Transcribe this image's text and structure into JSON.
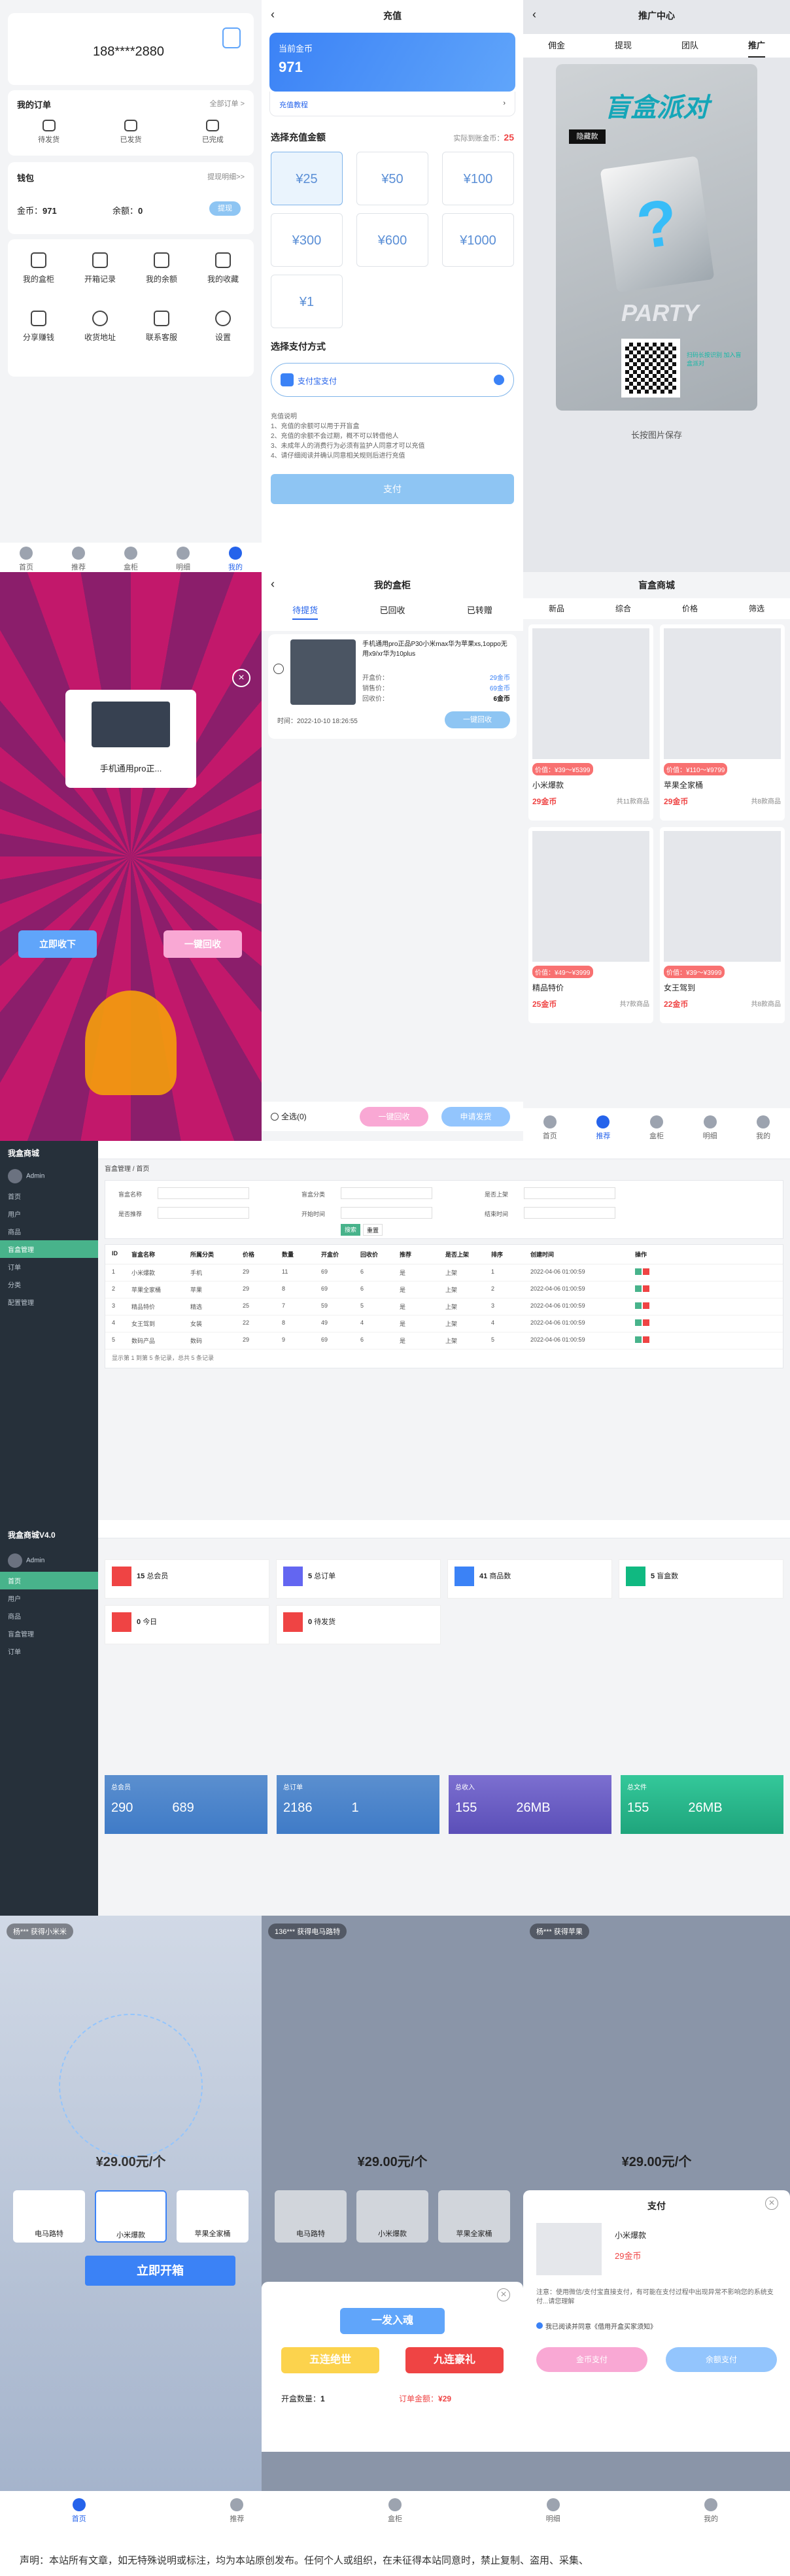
{
  "s1": {
    "phone": "188****2880",
    "orders_title": "我的订单",
    "orders_all": "全部订单 >",
    "order_tabs": [
      "待发货",
      "已发货",
      "已完成"
    ],
    "wallet_title": "钱包",
    "withdraw": "提现明细>>",
    "coin_label": "金币：",
    "coin_value": "971",
    "balance_label": "余额：",
    "balance_value": "0",
    "withdraw_btn": "提现",
    "grid": [
      "我的盒柜",
      "开箱记录",
      "我的余额",
      "我的收藏",
      "分享赚钱",
      "收货地址",
      "联系客服",
      "设置"
    ],
    "tabs": [
      "首页",
      "推荐",
      "盒柜",
      "明细",
      "我的"
    ]
  },
  "s2": {
    "title": "充值",
    "current_coin_label": "当前金币",
    "current_coin": "971",
    "tutorial": "充值教程",
    "select_label": "选择充值金额",
    "actual_label": "实际到账金币：",
    "actual_value": "25",
    "amounts": [
      "¥25",
      "¥50",
      "¥100",
      "¥300",
      "¥600",
      "¥1000",
      "¥1"
    ],
    "pay_method": "选择支付方式",
    "alipay": "支付宝支付",
    "notes": [
      "充值说明",
      "1、充值的余额可以用于开盲盒",
      "2、充值的余额不会过期，概不可以转借他人",
      "3、未成年人的消费行为必须有监护人同意才可以充值",
      "4、请仔细阅读并确认同意相关规则后进行充值"
    ],
    "pay_btn": "支付"
  },
  "s3": {
    "title": "推广中心",
    "tabs": [
      "佣金",
      "提现",
      "团队",
      "推广"
    ],
    "poster_title": "盲盒派对",
    "poster_tag": "隐藏款",
    "poster_sub": "PARTY",
    "qr_text": "扫码长按识别 加入盲盒派对",
    "save": "长按图片保存"
  },
  "s4": {
    "card_label": "手机通用pro正...",
    "btn_receive": "立即收下",
    "btn_recycle": "一键回收"
  },
  "s5": {
    "title": "我的盒柜",
    "tabs": [
      "待提货",
      "已回收",
      "已转赠"
    ],
    "product": "手机通用pro正品P30小米max华为苹果xs,1oppo无用x9/xr华为10plus",
    "open_price_label": "开盒价：",
    "open_price": "29金币",
    "sell_price_label": "销售价：",
    "sell_price": "69金币",
    "recycle_label": "回收价：",
    "recycle_price": "6金币",
    "time": "时间：2022-10-10 18:26:55",
    "one_recycle": "一键回收",
    "select_all": "全选(0)",
    "btn_recycle": "一键回收",
    "btn_ship": "申请发货"
  },
  "s6": {
    "title": "盲盒商城",
    "filters": [
      "新品",
      "综合",
      "价格",
      "筛选"
    ],
    "products": [
      {
        "name": "小米爆款",
        "range": "价值：¥39～¥5399",
        "price": "29金币",
        "count": "共11款商品"
      },
      {
        "name": "苹果全家桶",
        "range": "价值：¥110～¥9799",
        "price": "29金币",
        "count": "共8款商品"
      },
      {
        "name": "精品特价",
        "range": "价值：¥49～¥3999",
        "price": "25金币",
        "count": "共7款商品"
      },
      {
        "name": "女王驾到",
        "range": "价值：¥39～¥3999",
        "price": "22金币",
        "count": "共8款商品"
      }
    ],
    "tabs": [
      "首页",
      "推荐",
      "盒柜",
      "明细",
      "我的"
    ]
  },
  "a1": {
    "brand": "我盒商城",
    "user": "Admin",
    "menu": [
      "首页",
      "用户",
      "商品",
      "盲盒管理",
      "订单",
      "分类",
      "配置管理"
    ],
    "crumbs": [
      "盲盒管理",
      "首页"
    ],
    "form_labels": [
      "盲盒名称",
      "盲盒分类",
      "是否上架",
      "是否推荐",
      "开始时间",
      "结束时间"
    ],
    "btn_search": "搜索",
    "btn_reset": "重置",
    "columns": [
      "ID",
      "盲盒名称",
      "所属分类",
      "价格",
      "数量",
      "开盒价",
      "回收价",
      "推荐",
      "是否上架",
      "排序",
      "创建时间",
      "操作"
    ],
    "rows": [
      [
        "1",
        "小米爆款",
        "手机",
        "29",
        "11",
        "69",
        "6",
        "是",
        "上架",
        "1",
        "2022-04-06 01:00:59"
      ],
      [
        "2",
        "苹果全家桶",
        "苹果",
        "29",
        "8",
        "69",
        "6",
        "是",
        "上架",
        "2",
        "2022-04-06 01:00:59"
      ],
      [
        "3",
        "精品特价",
        "精选",
        "25",
        "7",
        "59",
        "5",
        "是",
        "上架",
        "3",
        "2022-04-06 01:00:59"
      ],
      [
        "4",
        "女王驾到",
        "女装",
        "22",
        "8",
        "49",
        "4",
        "是",
        "上架",
        "4",
        "2022-04-06 01:00:59"
      ],
      [
        "5",
        "数码产品",
        "数码",
        "29",
        "9",
        "69",
        "6",
        "是",
        "上架",
        "5",
        "2022-04-06 01:00:59"
      ]
    ],
    "footer": "显示第 1 到第 5 条记录，总共 5 条记录"
  },
  "a2": {
    "brand": "我盒商城V4.0",
    "user": "Admin",
    "stats": [
      {
        "v": "15",
        "l": "总会员"
      },
      {
        "v": "5",
        "l": "总订单"
      },
      {
        "v": "41",
        "l": "商品数"
      },
      {
        "v": "5",
        "l": "盲盒数"
      },
      {
        "v": "0",
        "l": "今日"
      },
      {
        "v": "0",
        "l": "待发货"
      }
    ],
    "cards": [
      {
        "t": "总会员",
        "a": "290",
        "b": "689"
      },
      {
        "t": "总订单",
        "a": "2186",
        "b": "1"
      },
      {
        "t": "总收入",
        "a": "155",
        "b": "26MB"
      },
      {
        "t": "总文件",
        "a": "155",
        "b": "26MB"
      }
    ]
  },
  "b1": {
    "user": "杨***",
    "action": "获得小米米",
    "price": "¥29.00元/个",
    "items": [
      "电马路特",
      "小米爆款",
      "苹果全家桶"
    ],
    "open_btn": "立即开箱"
  },
  "b2": {
    "user": "136***",
    "action": "获得电马路特",
    "price": "¥29.00元/个",
    "items": [
      "电马路特",
      "小米爆款",
      "苹果全家桶"
    ],
    "one": "一发入魂",
    "five": "五连绝世",
    "nine": "九连豪礼",
    "count_label": "开盒数量：",
    "count": "1",
    "amount_label": "订单金额：",
    "amount": "¥29"
  },
  "b3": {
    "user": "杨***",
    "action": "获得苹果",
    "price": "¥29.00元/个",
    "pay_title": "支付",
    "product": "小米爆款",
    "product_price": "29金币",
    "agree": "我已阅读并同意《借用开盒买家须知》",
    "notice": "注意：使用微信/支付宝直接支付，有可能在支付过程中出现异常不影响您的系统支付...请您理解",
    "coin_pay": "金币支付",
    "balance_pay": "余额支付",
    "tabs": [
      "首页",
      "推荐",
      "盒柜",
      "明细",
      "我的"
    ]
  },
  "footer": {
    "text": "声明：本站所有文章，如无特殊说明或标注，均为本站原创发布。任何个人或组织，在未征得本站同意时，禁止复制、盗用、采集、"
  }
}
